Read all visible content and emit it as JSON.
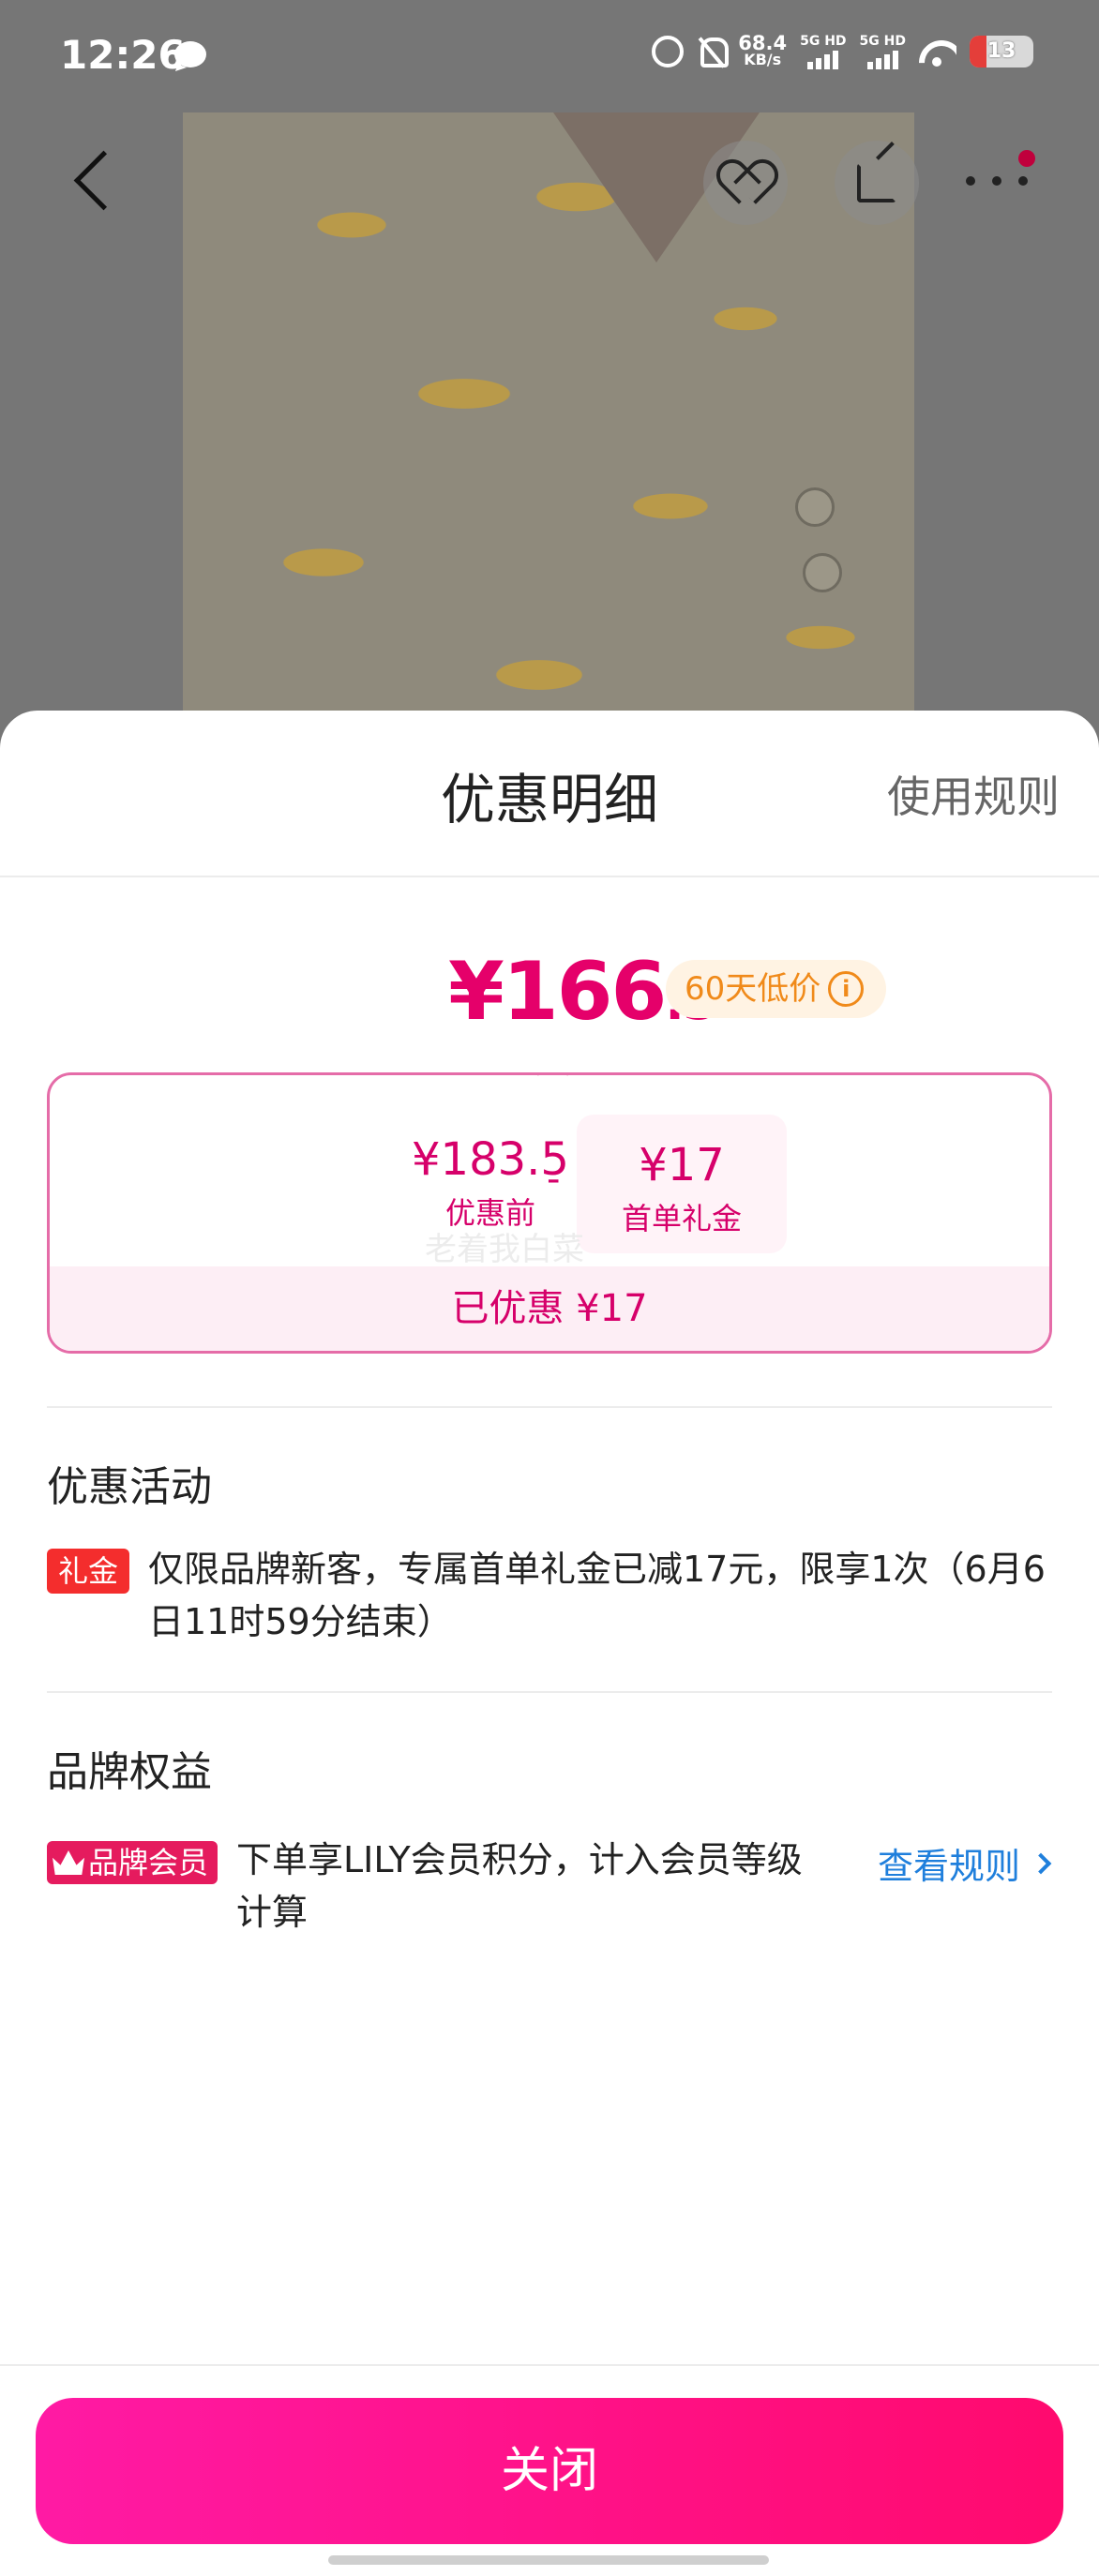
{
  "status_bar": {
    "time": "12:26",
    "net_speed_value": "68.4",
    "net_speed_unit": "KB/s",
    "sim1": "5G HD",
    "sim2": "5G HD",
    "battery": "13"
  },
  "nav": {
    "icons": [
      "back-icon",
      "favorite-add-icon",
      "share-icon",
      "more-icon"
    ]
  },
  "sheet": {
    "title": "优惠明细",
    "rules_link": "使用规则",
    "final_price_int": "¥166",
    "final_price_dec": ".5",
    "low_price_badge": "60天低价",
    "original_amount": "¥183.5",
    "original_label": "优惠前",
    "minus": "-",
    "coupon_amount": "¥17",
    "coupon_label": "首单礼金",
    "watermark": "老着我白菜",
    "saved_text": "已优惠 ¥17",
    "activities_title": "优惠活动",
    "activity_tag": "礼金",
    "activity_text": "仅限品牌新客，专属首单礼金已减17元，限享1次（6月6日11时59分结束）",
    "brand_title": "品牌权益",
    "member_tag": "品牌会员",
    "benefit_text": "下单享LILY会员积分，计入会员等级计算",
    "view_rules": "查看规则",
    "close_label": "关闭"
  },
  "colors": {
    "accent": "#e5006a",
    "badge_orange": "#f08a1a",
    "link_blue": "#1f7fdc",
    "close_button": "#ff0a6e"
  }
}
